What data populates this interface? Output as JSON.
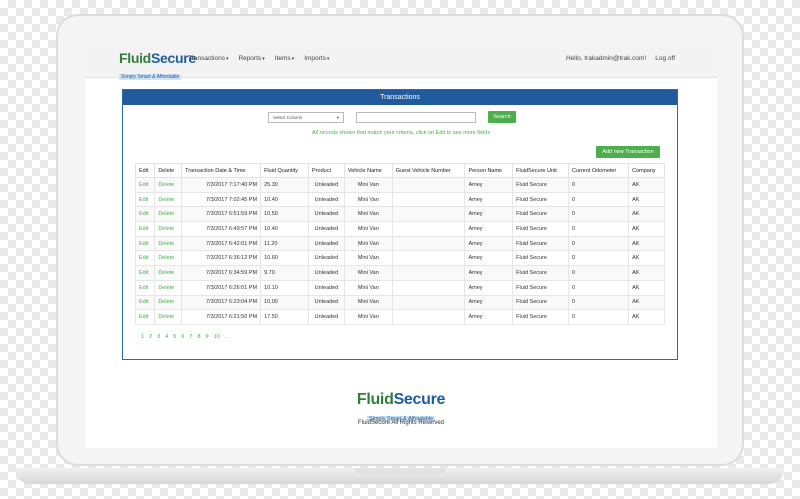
{
  "brand": {
    "name_part1": "Fluid",
    "name_part2": "Secure",
    "tagline": "Simply Smart & Affordable"
  },
  "nav": {
    "items": [
      {
        "label": "Transactions",
        "caret": "▾"
      },
      {
        "label": "Reports",
        "caret": "▾"
      },
      {
        "label": "Items",
        "caret": "▾"
      },
      {
        "label": "Imports",
        "caret": "▾"
      }
    ],
    "greeting": "Hello, trakadmin@trak.com!",
    "logoff": "Log off"
  },
  "panel": {
    "title": "Transactions",
    "select_value": "Select Column",
    "select_caret": "▾",
    "search_placeholder": "",
    "search_button": "Search",
    "hint": "All records shown that match your criteria, click on Edit to see more fields",
    "add_button": "Add new Transaction"
  },
  "table": {
    "headers": [
      "Edit",
      "Delete",
      "Transaction Date & Time",
      "Fluid Quantity",
      "Product",
      "Vehicle Name",
      "Guest Vehicle Number",
      "Person Name",
      "FluidSecure Unit",
      "Current Odometer",
      "Company"
    ],
    "rows": [
      {
        "edit": "Edit",
        "delete": "Delete",
        "date": "7/3/2017 7:17:40 PM",
        "qty": "25.30",
        "product": "Unleaded",
        "vehicle": "Mini Van",
        "guest": "",
        "person": "Amey",
        "unit": "Fluid Secure",
        "odometer": "0",
        "company": "AK"
      },
      {
        "edit": "Edit",
        "delete": "Delete",
        "date": "7/3/2017 7:02:45 PM",
        "qty": "10.40",
        "product": "Unleaded",
        "vehicle": "Mini Van",
        "guest": "",
        "person": "Amey",
        "unit": "Fluid Secure",
        "odometer": "0",
        "company": "AK"
      },
      {
        "edit": "Edit",
        "delete": "Delete",
        "date": "7/3/2017 6:51:59 PM",
        "qty": "10.50",
        "product": "Unleaded",
        "vehicle": "Mini Van",
        "guest": "",
        "person": "Amey",
        "unit": "Fluid Secure",
        "odometer": "0",
        "company": "AK"
      },
      {
        "edit": "Edit",
        "delete": "Delete",
        "date": "7/3/2017 6:49:57 PM",
        "qty": "10.40",
        "product": "Unleaded",
        "vehicle": "Mini Van",
        "guest": "",
        "person": "Amey",
        "unit": "Fluid Secure",
        "odometer": "0",
        "company": "AK"
      },
      {
        "edit": "Edit",
        "delete": "Delete",
        "date": "7/3/2017 6:42:01 PM",
        "qty": "11.20",
        "product": "Unleaded",
        "vehicle": "Mini Van",
        "guest": "",
        "person": "Amey",
        "unit": "Fluid Secure",
        "odometer": "0",
        "company": "AK"
      },
      {
        "edit": "Edit",
        "delete": "Delete",
        "date": "7/3/2017 6:36:12 PM",
        "qty": "10.60",
        "product": "Unleaded",
        "vehicle": "Mini Van",
        "guest": "",
        "person": "Amey",
        "unit": "Fluid Secure",
        "odometer": "0",
        "company": "AK"
      },
      {
        "edit": "Edit",
        "delete": "Delete",
        "date": "7/3/2017 6:34:59 PM",
        "qty": "9.70",
        "product": "Unleaded",
        "vehicle": "Mini Van",
        "guest": "",
        "person": "Amey",
        "unit": "Fluid Secure",
        "odometer": "0",
        "company": "AK"
      },
      {
        "edit": "Edit",
        "delete": "Delete",
        "date": "7/3/2017 6:26:01 PM",
        "qty": "10.10",
        "product": "Unleaded",
        "vehicle": "Mini Van",
        "guest": "",
        "person": "Amey",
        "unit": "Fluid Secure",
        "odometer": "0",
        "company": "AK"
      },
      {
        "edit": "Edit",
        "delete": "Delete",
        "date": "7/3/2017 6:23:04 PM",
        "qty": "10.00",
        "product": "Unleaded",
        "vehicle": "Mini Van",
        "guest": "",
        "person": "Amey",
        "unit": "Fluid Secure",
        "odometer": "0",
        "company": "AK"
      },
      {
        "edit": "Edit",
        "delete": "Delete",
        "date": "7/3/2017 6:21:50 PM",
        "qty": "17.50",
        "product": "Unleaded",
        "vehicle": "Mini Van",
        "guest": "",
        "person": "Amey",
        "unit": "Fluid Secure",
        "odometer": "0",
        "company": "AK"
      }
    ]
  },
  "pagination": {
    "pages": [
      "1",
      "2",
      "3",
      "4",
      "5",
      "6",
      "7",
      "8",
      "9",
      "10"
    ],
    "ellipsis": "..."
  },
  "footer": {
    "copyright": "FluidSecure All Rights Reserved"
  },
  "colors": {
    "brand_blue": "#215b9d",
    "accent_green": "#4cae4c",
    "logo_green": "#2f7f3a"
  }
}
